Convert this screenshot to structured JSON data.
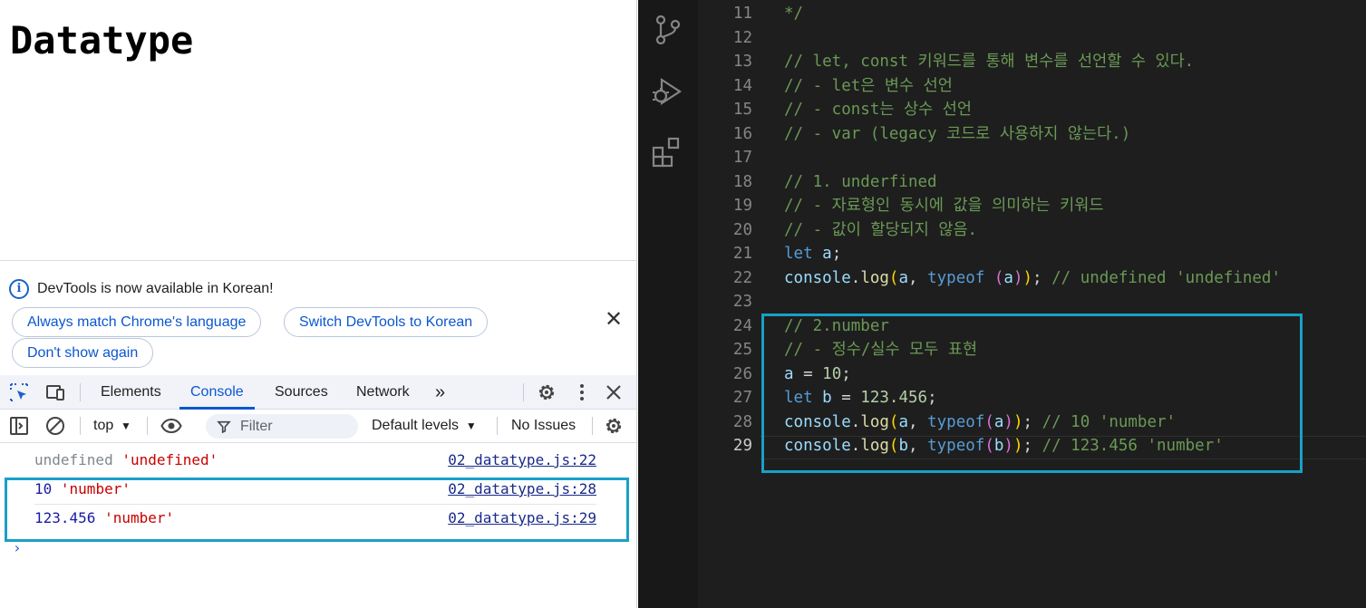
{
  "page": {
    "title": "Datatype"
  },
  "devtools": {
    "notice": {
      "text": "DevTools is now available in Korean!",
      "btn_match": "Always match Chrome's language",
      "btn_switch": "Switch DevTools to Korean",
      "btn_dont": "Don't show again",
      "close": "✕"
    },
    "tabs": [
      "Elements",
      "Console",
      "Sources",
      "Network"
    ],
    "more_tabs": "»",
    "toolbar": {
      "context": "top",
      "filter": "Filter",
      "levels": "Default levels",
      "issues": "No Issues"
    },
    "console": {
      "lines": [
        {
          "value": "undefined",
          "type_str": "'undefined'",
          "source": "02_datatype.js:22"
        },
        {
          "value": "10",
          "type_str": "'number'",
          "source": "02_datatype.js:28"
        },
        {
          "value": "123.456",
          "type_str": "'number'",
          "source": "02_datatype.js:29"
        }
      ],
      "prompt": "›"
    }
  },
  "editor": {
    "lines": [
      {
        "n": "11",
        "text": "*/"
      },
      {
        "n": "12",
        "text": ""
      },
      {
        "n": "13",
        "text": "// let, const 키워드를 통해 변수를 선언할 수 있다."
      },
      {
        "n": "14",
        "text": "// - let은 변수 선언"
      },
      {
        "n": "15",
        "text": "// - const는 상수 선언"
      },
      {
        "n": "16",
        "text": "// - var (legacy 코드로 사용하지 않는다.)"
      },
      {
        "n": "17",
        "text": ""
      },
      {
        "n": "18",
        "text": "// 1. underfined"
      },
      {
        "n": "19",
        "text": "// - 자료형인 동시에 값을 의미하는 키워드"
      },
      {
        "n": "20",
        "text": "// - 값이 할당되지 않음."
      },
      {
        "n": "21",
        "text": "let a;"
      },
      {
        "n": "22",
        "text": "console.log(a, typeof (a)); // undefined 'undefined'"
      },
      {
        "n": "23",
        "text": ""
      },
      {
        "n": "24",
        "text": "// 2.number"
      },
      {
        "n": "25",
        "text": "// - 정수/실수 모두 표현"
      },
      {
        "n": "26",
        "text": "a = 10;"
      },
      {
        "n": "27",
        "text": "let b = 123.456;"
      },
      {
        "n": "28",
        "text": "console.log(a, typeof(a)); // 10 'number'"
      },
      {
        "n": "29",
        "text": "console.log(b, typeof(b)); // 123.456 'number'"
      }
    ],
    "active_line": "29"
  },
  "colors": {
    "highlight": "#19a0c8",
    "editor_bg": "#1e1e1e",
    "comment": "#6a9955",
    "keyword": "#569cd6"
  },
  "icons": {
    "activity": [
      "source-control-icon",
      "run-debug-icon",
      "extensions-icon"
    ],
    "devtools": [
      "inspect-element-icon",
      "device-toolbar-icon",
      "settings-icon",
      "more-vert-icon",
      "close-icon"
    ]
  }
}
